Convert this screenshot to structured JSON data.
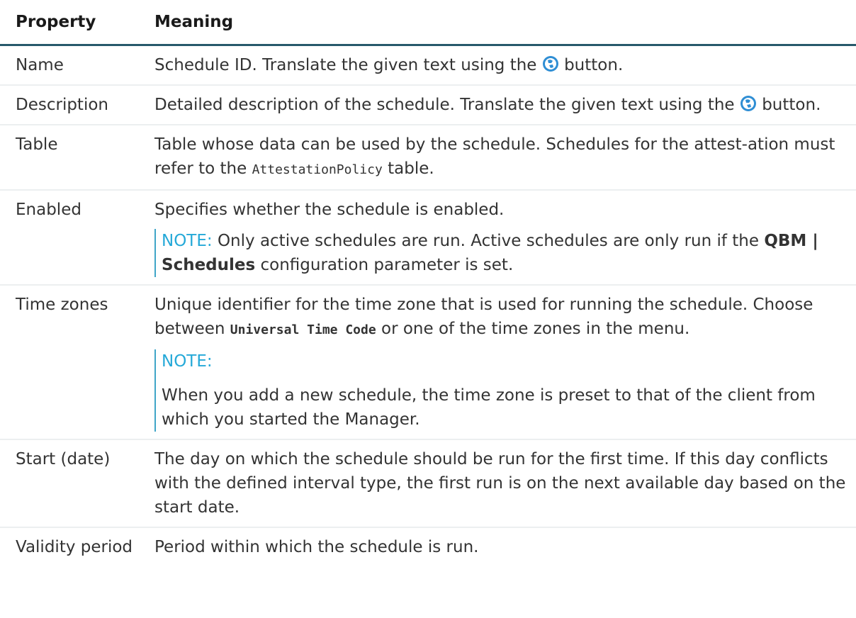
{
  "header": {
    "property": "Property",
    "meaning": "Meaning"
  },
  "rows": [
    {
      "name": "Name",
      "text_a": "Schedule ID. Translate the given text using the",
      "text_b": "button."
    },
    {
      "name": "Description",
      "text_a": "Detailed description of the schedule. Translate the given text using the",
      "text_b": "button."
    },
    {
      "name": "Table",
      "text_a": "Table whose data can be used by the schedule. Schedules for the attest-ation must refer to the",
      "code": "AttestationPolicy",
      "text_b": "table."
    },
    {
      "name": "Enabled",
      "text": "Specifies whether the schedule is enabled.",
      "note_label": "NOTE:",
      "note_a": "Only active schedules are run. Active schedules are only run if the",
      "note_bold": "QBM | Schedules",
      "note_b": "configuration parameter is set."
    },
    {
      "name": "Time zones",
      "text_a": "Unique identifier for the time zone that is used for running the schedule. Choose between",
      "code": "Universal Time Code",
      "text_b": "or one of the time zones in the menu.",
      "note_label": "NOTE:",
      "note_text": "When you add a new schedule, the time zone is preset to that of the client from which you started the Manager."
    },
    {
      "name": "Start (date)",
      "text": "The day on which the schedule should be run for the first time. If this day conflicts with the defined interval type, the first run is on the next available day based on the start date."
    },
    {
      "name": "Validity period",
      "text": "Period within which the schedule is run."
    }
  ]
}
